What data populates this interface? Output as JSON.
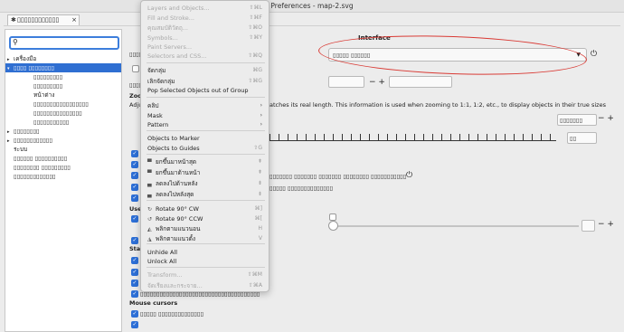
{
  "window": {
    "title": "Preferences - map-2.svg"
  },
  "tab": {
    "label": "▯▯▯▯▯▯▯▯▯▯▯▯",
    "close": "×"
  },
  "sidebar": {
    "search_placeholder": "",
    "items": [
      {
        "label": "เครื่องมือ",
        "arrow": "▸",
        "indent": 0,
        "selected": false
      },
      {
        "label": "▯▯▯▯ ▯▯▯▯▯▯▯▯",
        "arrow": "▾",
        "indent": 0,
        "selected": true
      },
      {
        "label": "▯▯▯▯▯▯▯▯▯",
        "arrow": "",
        "indent": 1,
        "selected": false
      },
      {
        "label": "▯▯▯▯▯▯▯▯▯",
        "arrow": "",
        "indent": 1,
        "selected": false
      },
      {
        "label": "หน้าต่าง",
        "arrow": "",
        "indent": 1,
        "selected": false
      },
      {
        "label": "▯▯▯▯▯▯▯▯▯▯▯▯▯▯▯▯▯",
        "arrow": "",
        "indent": 1,
        "selected": false
      },
      {
        "label": "▯▯▯▯▯▯▯▯▯▯▯▯▯▯▯",
        "arrow": "",
        "indent": 1,
        "selected": false
      },
      {
        "label": "▯▯▯▯▯▯▯▯▯▯▯",
        "arrow": "",
        "indent": 1,
        "selected": false
      },
      {
        "label": "▯▯▯▯▯▯▯▯",
        "arrow": "▸",
        "indent": 0,
        "selected": false
      },
      {
        "label": "▯▯▯▯▯▯▯▯▯▯▯▯",
        "arrow": "▸",
        "indent": 0,
        "selected": false
      },
      {
        "label": "ระบบ",
        "arrow": "",
        "indent": 0,
        "selected": false
      },
      {
        "label": "▯▯▯▯▯▯ ▯▯▯▯▯▯▯▯▯▯",
        "arrow": "",
        "indent": 0,
        "selected": false
      },
      {
        "label": "▯▯▯▯▯▯▯▯ ▯▯▯▯▯▯▯▯▯",
        "arrow": "",
        "indent": 0,
        "selected": false
      },
      {
        "label": "▯▯▯▯▯▯▯▯▯▯▯▯▯",
        "arrow": "",
        "indent": 0,
        "selected": false
      }
    ]
  },
  "interface": {
    "section_title": "Interface",
    "language_value": "▯▯▯▯▯ ▯▯▯▯▯▯",
    "zoom_label": "Zoom",
    "adjust_text": "Adjust",
    "ruler_note": "atches its real length. This information is used when zooming to 1:1, 1:2, etc., to display objects in their true sizes",
    "spin_value": "▯▯▯▯▯▯▯",
    "user_label": "Use",
    "status_label": "Statu",
    "mouse_cursors_label": "Mouse cursors",
    "right_combo_value": "▯▯▯▯▯▯▯▯",
    "unit_combo_value": "▯▯",
    "labels": [
      "▯▯▯▯▯▯▯ ▯▯▯▯▯▯▯ ▯▯▯▯▯▯▯ ▯▯▯▯▯▯▯▯ ▯▯▯▯▯▯▯▯▯▯▯",
      "▯▯▯▯▯▯▯▯▯▯▯▯▯▯▯▯▯▯▯▯▯▯▯▯▯",
      "▯▯▯▯▯ ▯▯▯▯▯▯▯▯▯▯▯▯▯▯",
      "▯▯▯▯▯▯▯▯▯▯▯▯▯▯▯▯▯▯▯▯▯▯▯▯▯▯▯▯▯▯▯▯▯▯▯▯▯"
    ]
  },
  "menu": {
    "items": [
      {
        "label": "Layers and Objects...",
        "shortcut": "⇧⌘L",
        "disabled": true,
        "icon": ""
      },
      {
        "label": "Fill and Stroke...",
        "shortcut": "⇧⌘F",
        "disabled": true,
        "icon": ""
      },
      {
        "label": "คุณสมบัติวัตถุ...",
        "shortcut": "⇧⌘O",
        "disabled": true,
        "icon": ""
      },
      {
        "label": "Symbols...",
        "shortcut": "⇧⌘Y",
        "disabled": true,
        "icon": ""
      },
      {
        "label": "Paint Servers...",
        "shortcut": "",
        "disabled": true,
        "icon": ""
      },
      {
        "label": "Selectors and CSS...",
        "shortcut": "⇧⌘Q",
        "disabled": true,
        "icon": ""
      },
      {
        "label": "จัดกลุ่ม",
        "shortcut": "⌘G",
        "disabled": false,
        "icon": ""
      },
      {
        "label": "เลิกจัดกลุ่ม",
        "shortcut": "⇧⌘G",
        "disabled": false,
        "icon": ""
      },
      {
        "label": "Pop Selected Objects out of Group",
        "shortcut": "",
        "disabled": false,
        "icon": ""
      },
      {
        "label": "คลิป",
        "shortcut": "",
        "submenu": "›",
        "disabled": false,
        "icon": ""
      },
      {
        "label": "Mask",
        "shortcut": "",
        "submenu": "›",
        "disabled": false,
        "icon": ""
      },
      {
        "label": "Pattern",
        "shortcut": "",
        "submenu": "›",
        "disabled": false,
        "icon": ""
      },
      {
        "label": "Objects to Marker",
        "shortcut": "",
        "disabled": false,
        "icon": ""
      },
      {
        "label": "Objects to Guides",
        "shortcut": "⇧G",
        "disabled": false,
        "icon": ""
      },
      {
        "label": "ยกขึ้นมาหน้าสุด",
        "shortcut": "⇞",
        "disabled": false,
        "icon": "▀"
      },
      {
        "label": "ยกขึ้นมาด้านหน้า",
        "shortcut": "⇞",
        "disabled": false,
        "icon": "▀"
      },
      {
        "label": "ลดลงไปด้านหลัง",
        "shortcut": "⇟",
        "disabled": false,
        "icon": "▄"
      },
      {
        "label": "ลดลงไปหลังสุด",
        "shortcut": "⇟",
        "disabled": false,
        "icon": "▄"
      },
      {
        "label": "Rotate 90° CW",
        "shortcut": "⌘]",
        "disabled": false,
        "icon": "↻"
      },
      {
        "label": "Rotate 90° CCW",
        "shortcut": "⌘[",
        "disabled": false,
        "icon": "↺"
      },
      {
        "label": "พลิกตามแนวนอน",
        "shortcut": "H",
        "disabled": false,
        "icon": "◭"
      },
      {
        "label": "พลิกตามแนวตั้ง",
        "shortcut": "V",
        "disabled": false,
        "icon": "◮"
      },
      {
        "label": "Unhide All",
        "shortcut": "",
        "disabled": false,
        "icon": ""
      },
      {
        "label": "Unlock All",
        "shortcut": "",
        "disabled": false,
        "icon": ""
      },
      {
        "label": "Transform...",
        "shortcut": "⇧⌘M",
        "disabled": true,
        "icon": ""
      },
      {
        "label": "จัดเรียงและกระจาย...",
        "shortcut": "⇧⌘A",
        "disabled": true,
        "icon": ""
      }
    ]
  }
}
